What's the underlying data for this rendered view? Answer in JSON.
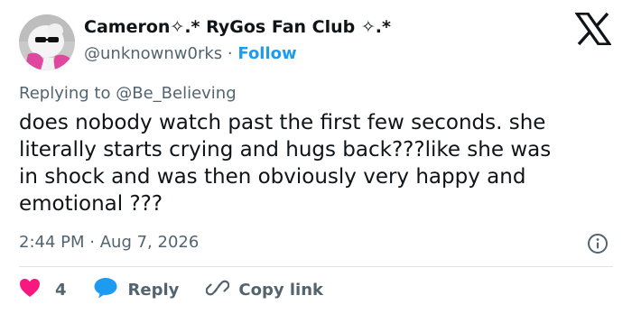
{
  "author": {
    "display_name": "Cameron✧.* RyGos Fan Club ✧.*",
    "handle": "@unknownw0rks",
    "separator": "·",
    "follow_label": "Follow"
  },
  "reply_context": {
    "prefix": "Replying to",
    "mention": "@Be_Believing"
  },
  "tweet": {
    "lines": [
      "does nobody watch past the first few seconds. she",
      "literally starts crying and hugs back???like she was",
      "in shock and was then obviously very happy and",
      "emotional ???"
    ],
    "time": "2:44 PM",
    "dot": "·",
    "date": "Aug 7, 2026"
  },
  "actions": {
    "likes": "4",
    "reply_label": "Reply",
    "copy_label": "Copy link"
  },
  "icons": {
    "brand": "x-logo-icon",
    "info": "info-icon",
    "like": "heart-icon",
    "reply": "speech-bubble-icon",
    "copy": "link-icon"
  },
  "colors": {
    "text": "#0f1419",
    "muted": "#536471",
    "link": "#1d9bf0",
    "heart": "#f91880",
    "divider": "#dfe3e6"
  }
}
